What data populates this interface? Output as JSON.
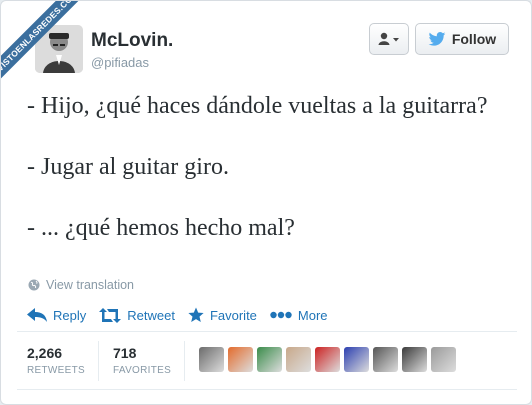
{
  "watermark": "VISTOENLASREDES.COM",
  "user": {
    "name": "McLovin.",
    "handle": "@pifiadas"
  },
  "buttons": {
    "follow_label": "Follow",
    "user_menu_icon": "user-dropdown-icon"
  },
  "tweet": {
    "lines": [
      "- Hijo, ¿qué haces dándole vueltas a la guitarra?",
      "- Jugar al guitar giro.",
      "- ... ¿qué hemos hecho mal?"
    ]
  },
  "translate_label": "View translation",
  "actions": {
    "reply": "Reply",
    "retweet": "Retweet",
    "favorite": "Favorite",
    "more": "More"
  },
  "stats": {
    "retweets_count": "2,266",
    "retweets_label": "RETWEETS",
    "favorites_count": "718",
    "favorites_label": "FAVORITES"
  },
  "favoriters": [
    {
      "color": "#6b6b6b"
    },
    {
      "color": "#e36b2c"
    },
    {
      "color": "#3a8c4a"
    },
    {
      "color": "#c8a88a"
    },
    {
      "color": "#cc2222"
    },
    {
      "color": "#2c3fb0"
    },
    {
      "color": "#555555"
    },
    {
      "color": "#3a3a3a"
    },
    {
      "color": "#9a9a9a"
    }
  ],
  "colors": {
    "link": "#1f74b7",
    "ribbon": "#3b6f9e",
    "twitter_blue": "#55acee"
  }
}
